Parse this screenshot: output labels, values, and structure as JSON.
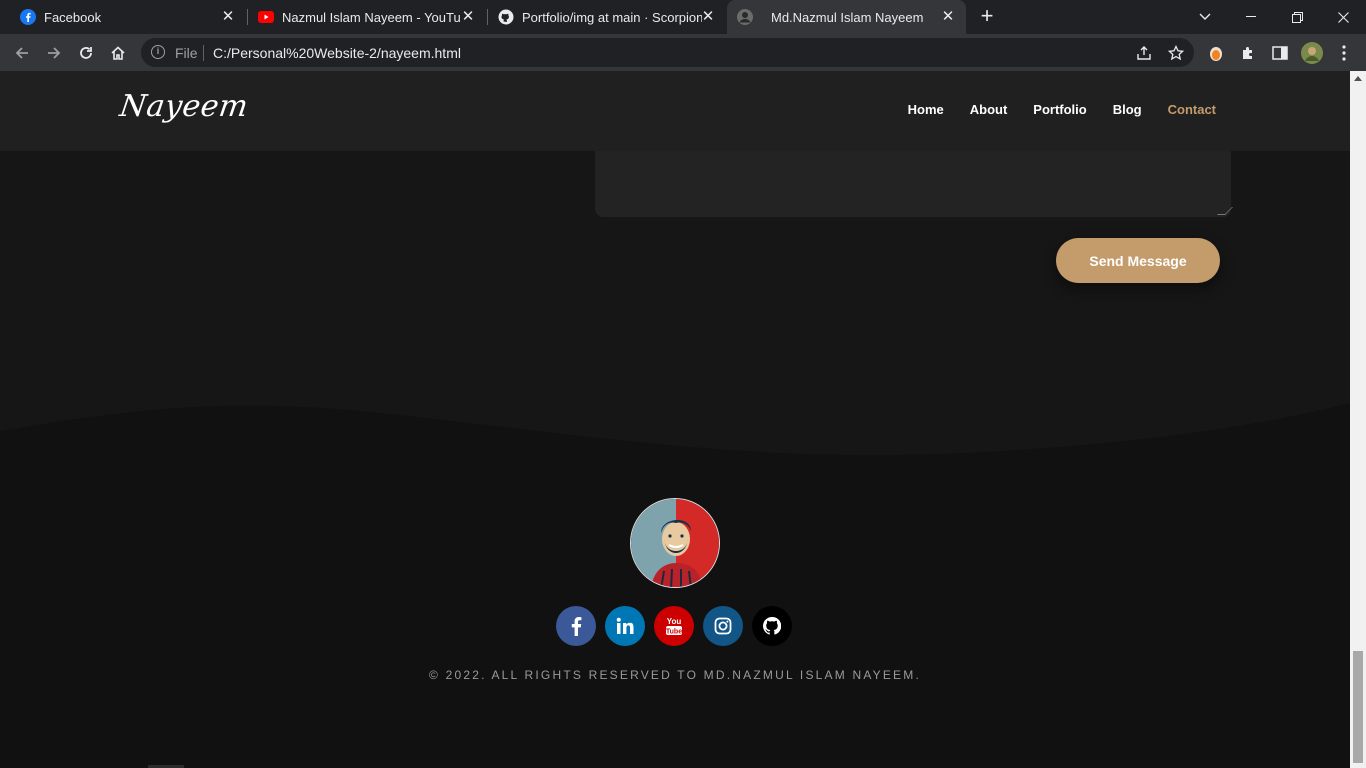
{
  "browser": {
    "tabs": [
      {
        "title": "Facebook",
        "icon": "facebook-icon",
        "active": false
      },
      {
        "title": "Nazmul Islam Nayeem - YouTube",
        "icon": "youtube-icon",
        "active": false
      },
      {
        "title": "Portfolio/img at main · ScorpionN",
        "icon": "github-icon",
        "active": false
      },
      {
        "title": "Md.Nazmul Islam Nayeem",
        "icon": "profile-icon",
        "active": true
      }
    ],
    "address": {
      "scheme_label": "File",
      "url": "C:/Personal%20Website-2/nayeem.html"
    }
  },
  "site": {
    "logo": "Nayeem",
    "nav": [
      {
        "label": "Home",
        "active": false
      },
      {
        "label": "About",
        "active": false
      },
      {
        "label": "Portfolio",
        "active": false
      },
      {
        "label": "Blog",
        "active": false
      },
      {
        "label": "Contact",
        "active": true
      }
    ],
    "send_button": "Send Message",
    "footer": {
      "socials": [
        {
          "name": "facebook",
          "color": "#3b5998"
        },
        {
          "name": "linkedin",
          "color": "#0077b5"
        },
        {
          "name": "youtube",
          "color": "#cc0000"
        },
        {
          "name": "instagram",
          "color": "#125688"
        },
        {
          "name": "github",
          "color": "#000000"
        }
      ],
      "copyright": "© 2022. ALL RIGHTS RESERVED TO MD.NAZMUL ISLAM NAYEEM."
    }
  },
  "colors": {
    "accent": "#c49b6b",
    "page_bg": "#161616",
    "footer_bg": "#111111"
  }
}
